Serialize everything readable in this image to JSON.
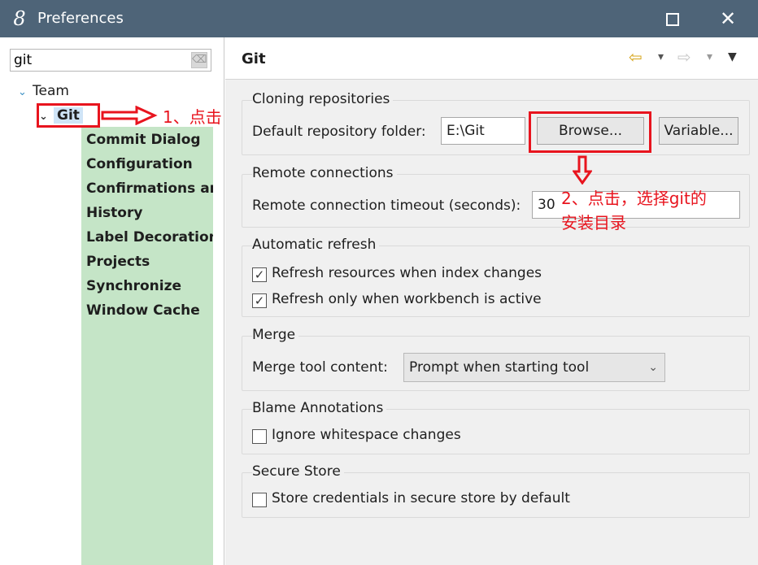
{
  "window": {
    "icon": "eclipse-8-icon",
    "title": "Preferences",
    "maximize_label": "",
    "close_label": "✕"
  },
  "filter": {
    "value": "git",
    "clear_glyph": "⌫"
  },
  "tree": {
    "team_label": "Team",
    "git_label": "Git",
    "children": [
      "Commit Dialog",
      "Configuration",
      "Confirmations ar",
      "History",
      "Label Decoration",
      "Projects",
      "Synchronize",
      "Window Cache"
    ]
  },
  "page": {
    "title": "Git"
  },
  "cloning": {
    "title": "Cloning repositories",
    "folder_label": "Default repository folder:",
    "folder_value": "E:\\Git",
    "browse_label": "Browse...",
    "variable_label": "Variable..."
  },
  "remote": {
    "title": "Remote connections",
    "timeout_label": "Remote connection timeout (seconds):",
    "timeout_value": "30"
  },
  "refresh": {
    "title": "Automatic refresh",
    "opt1": "Refresh resources when index changes",
    "opt1_checked": true,
    "opt2": "Refresh only when workbench is active",
    "opt2_checked": true
  },
  "merge": {
    "title": "Merge",
    "tool_label": "Merge tool content:",
    "tool_value": "Prompt when starting tool"
  },
  "blame": {
    "title": "Blame Annotations",
    "opt": "Ignore whitespace changes",
    "opt_checked": false
  },
  "secure": {
    "title": "Secure Store",
    "opt": "Store credentials in secure store by default",
    "opt_checked": false
  },
  "annotations": {
    "step1": "1、点击",
    "step2_line1": "2、点击，选择git的",
    "step2_line2": "安装目录",
    "color": "#e8141e"
  },
  "glyphs": {
    "check": "✓",
    "chev_down": "⌄",
    "tree_open": "⌄",
    "nav_back": "⇦",
    "nav_fwd": "⇨",
    "dd": "▾",
    "menu": "▼"
  }
}
